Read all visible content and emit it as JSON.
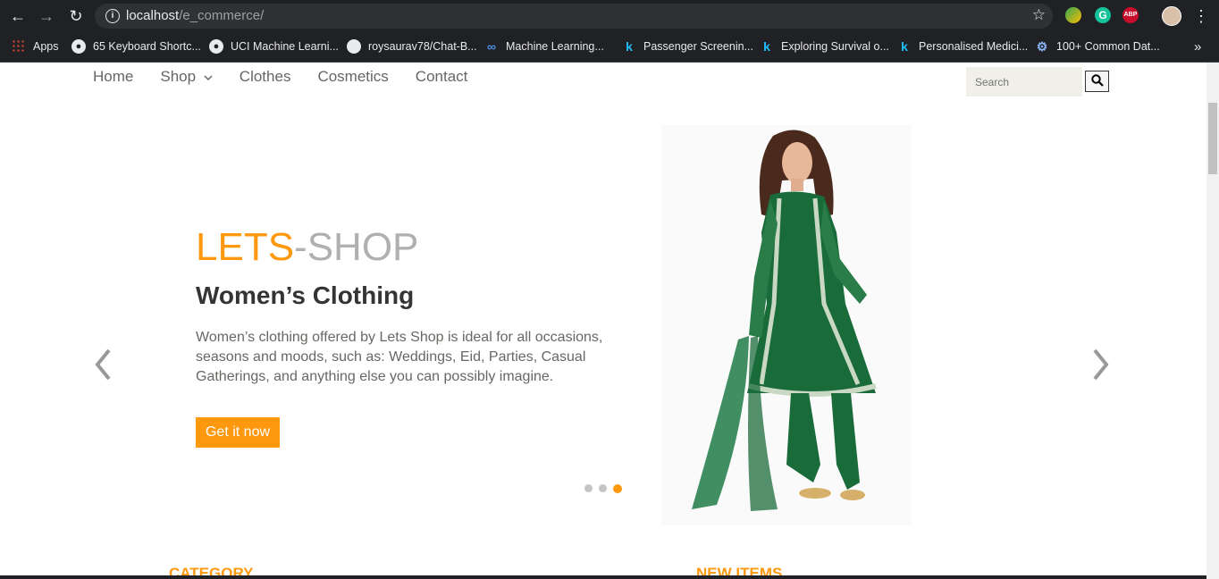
{
  "browser": {
    "url_host": "localhost",
    "url_path": "/e_commerce/",
    "bookmarks": [
      {
        "label": "Apps",
        "icon": "apps-grid-icon"
      },
      {
        "label": "65 Keyboard Shortc...",
        "icon": "globe-icon"
      },
      {
        "label": "UCI Machine Learni...",
        "icon": "globe-icon"
      },
      {
        "label": "roysaurav78/Chat-B...",
        "icon": "github-icon"
      },
      {
        "label": "Machine Learning...",
        "icon": "infinity-icon"
      },
      {
        "label": "Passenger Screenin...",
        "icon": "kaggle-icon"
      },
      {
        "label": "Exploring Survival o...",
        "icon": "kaggle-icon"
      },
      {
        "label": "Personalised Medici...",
        "icon": "kaggle-icon"
      },
      {
        "label": "100+ Common Dat...",
        "icon": "gear-icon"
      }
    ],
    "ext_abp": "ABP",
    "ext_grammarly": "G"
  },
  "nav": {
    "items": [
      "Home",
      "Shop",
      "Clothes",
      "Cosmetics",
      "Contact"
    ],
    "search_placeholder": "Search"
  },
  "slider": {
    "brand_part1": "LETS",
    "brand_part2": "-SHOP",
    "heading": "Women’s Clothing",
    "description": "Women’s clothing offered by Lets Shop is ideal for all occasions, seasons and moods, such as: Weddings, Eid, Parties, Casual Gatherings, and anything else you can possibly imagine.",
    "cta": "Get it now",
    "active_slide": 3,
    "slide_count": 3
  },
  "sections": {
    "category": "CATEGORY",
    "new_items": "NEW ITEMS"
  },
  "colors": {
    "accent": "#fe980f",
    "chrome": "#202124",
    "dress_green": "#1a6b3a"
  }
}
